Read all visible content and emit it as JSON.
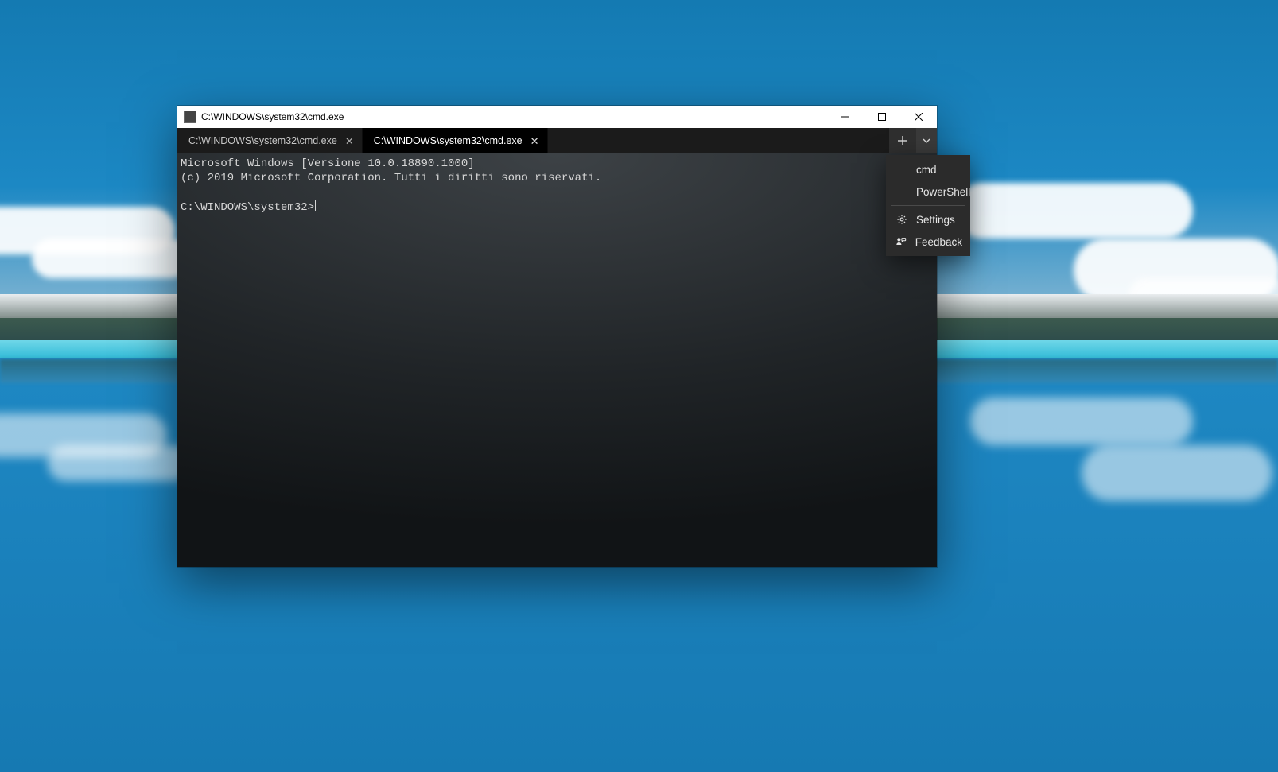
{
  "window": {
    "title": "C:\\WINDOWS\\system32\\cmd.exe"
  },
  "tabs": [
    {
      "label": "C:\\WINDOWS\\system32\\cmd.exe",
      "active": false
    },
    {
      "label": "C:\\WINDOWS\\system32\\cmd.exe",
      "active": true
    }
  ],
  "terminal": {
    "line1": "Microsoft Windows [Versione 10.0.18890.1000]",
    "line2": "(c) 2019 Microsoft Corporation. Tutti i diritti sono riservati.",
    "prompt": "C:\\WINDOWS\\system32>"
  },
  "dropdown": {
    "items_shell": [
      {
        "label": "cmd"
      },
      {
        "label": "PowerShell"
      }
    ],
    "items_other": [
      {
        "label": "Settings",
        "icon": "gear-icon"
      },
      {
        "label": "Feedback",
        "icon": "feedback-icon"
      }
    ]
  }
}
